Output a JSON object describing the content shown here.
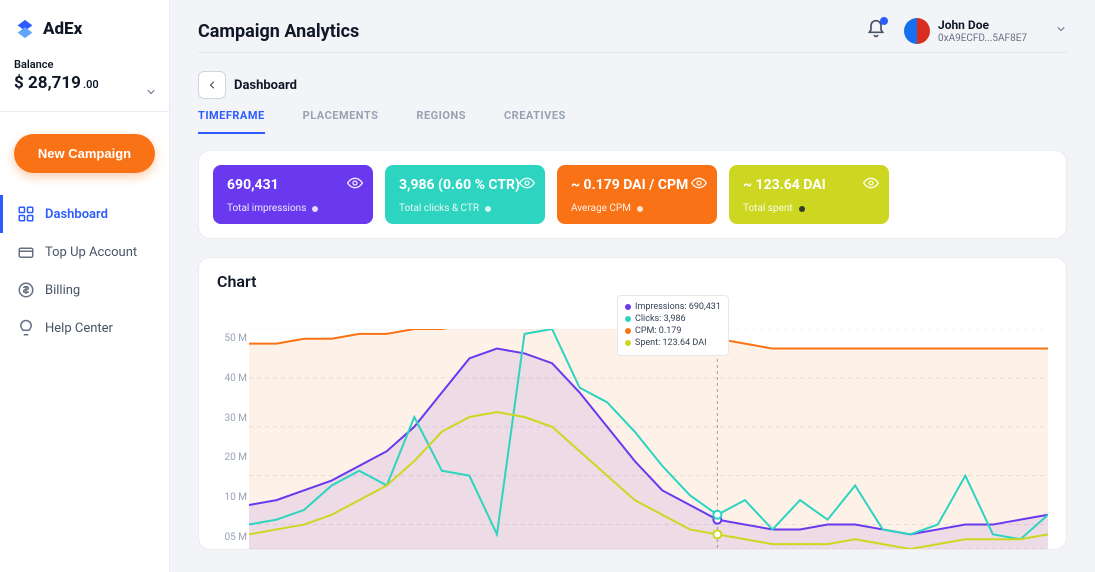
{
  "brand": {
    "name": "AdEx"
  },
  "balance": {
    "label": "Balance",
    "main": "$ 28,719",
    "cents": ".00"
  },
  "cta": {
    "new_campaign": "New Campaign"
  },
  "nav": {
    "dashboard": "Dashboard",
    "topup": "Top Up Account",
    "billing": "Billing",
    "help": "Help Center"
  },
  "user": {
    "name": "John Doe",
    "addr": "0xA9ECFD...5AF8E7"
  },
  "page": {
    "title": "Campaign Analytics",
    "back": "Dashboard"
  },
  "tabs": {
    "timeframe": "TIMEFRAME",
    "placements": "PLACEMENTS",
    "regions": "REGIONS",
    "creatives": "CREATIVES"
  },
  "kpis": {
    "impressions": {
      "value": "690,431",
      "sub": "Total impressions"
    },
    "clicks": {
      "value": "3,986 (0.60 % CTR)",
      "sub": "Total clicks & CTR"
    },
    "cpm": {
      "value": "~ 0.179 DAI / CPM",
      "sub": "Average CPM"
    },
    "spent": {
      "value": "~ 123.64 DAI",
      "sub": "Total spent"
    }
  },
  "chart": {
    "title": "Chart",
    "legend": {
      "impressions": "Impressions: 690,431",
      "clicks": "Clicks: 3,986",
      "cpm": "CPM: 0.179",
      "spent": "Spent: 123.64 DAI"
    },
    "yticks": [
      "50 M",
      "40 M",
      "30 M",
      "20 M",
      "10 M",
      "05 M"
    ]
  },
  "chart_data": {
    "type": "line",
    "ylabel": "",
    "xlabel": "",
    "ylim": [
      5,
      50
    ],
    "x": [
      0,
      1,
      2,
      3,
      4,
      5,
      6,
      7,
      8,
      9,
      10,
      11,
      12,
      13,
      14,
      15,
      16,
      17,
      18,
      19,
      20,
      21,
      22,
      23,
      24,
      25,
      26,
      27,
      28,
      29
    ],
    "yticks": [
      50,
      40,
      30,
      20,
      10,
      5
    ],
    "series": [
      {
        "name": "Impressions",
        "color": "#6938ef",
        "values": [
          14,
          15,
          17,
          19,
          22,
          25,
          30,
          37,
          44,
          46,
          45,
          43,
          37,
          30,
          23,
          17,
          14,
          11,
          10,
          9,
          9,
          10,
          10,
          9,
          8,
          9,
          10,
          10,
          11,
          12
        ]
      },
      {
        "name": "Clicks",
        "color": "#2dd4bf",
        "values": [
          10,
          11,
          13,
          18,
          21,
          18,
          32,
          21,
          20,
          8,
          49,
          50,
          38,
          35,
          29,
          22,
          16,
          12,
          15,
          9,
          15,
          11,
          18,
          9,
          8,
          10,
          20,
          8,
          7,
          12
        ]
      },
      {
        "name": "CPM",
        "color": "#f97316",
        "values": [
          47,
          47,
          48,
          48,
          49,
          49,
          50,
          50,
          51,
          51,
          51,
          51,
          51,
          51,
          50,
          50,
          49,
          48,
          47,
          46,
          46,
          46,
          46,
          46,
          46,
          46,
          46,
          46,
          46,
          46
        ]
      },
      {
        "name": "Spent",
        "color": "#cdd721",
        "values": [
          8,
          9,
          10,
          12,
          15,
          18,
          23,
          29,
          32,
          33,
          32,
          30,
          25,
          20,
          15,
          12,
          9,
          8,
          7,
          6,
          6,
          6,
          7,
          6,
          5,
          6,
          7,
          7,
          7,
          8
        ]
      }
    ],
    "cursor_index": 17
  }
}
